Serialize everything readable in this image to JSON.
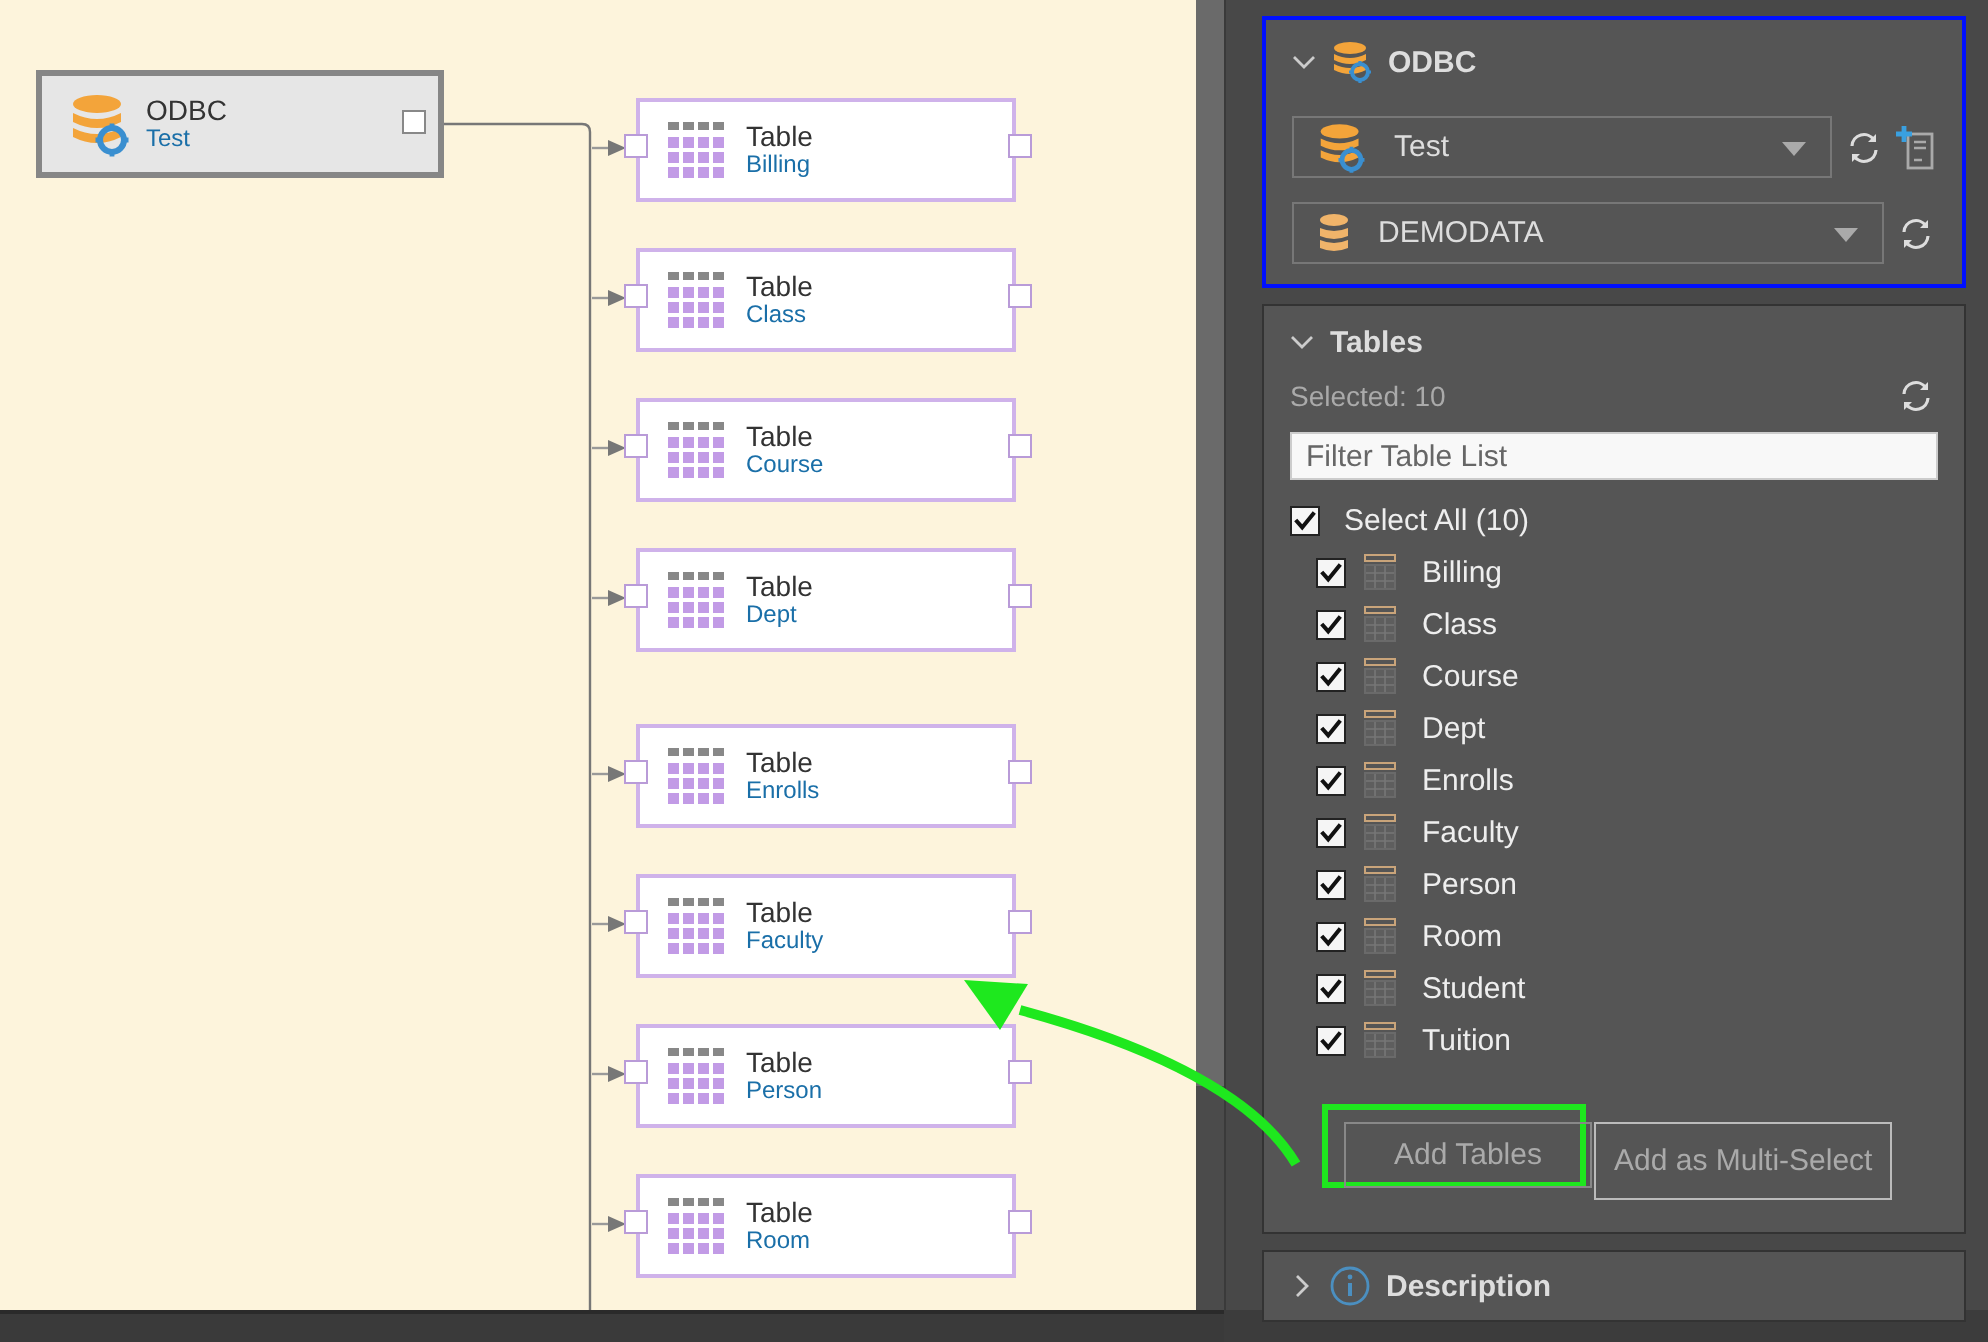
{
  "canvas": {
    "source_node": {
      "title": "ODBC",
      "subtitle": "Test"
    },
    "table_nodes": [
      {
        "title": "Table",
        "name": "Billing"
      },
      {
        "title": "Table",
        "name": "Class"
      },
      {
        "title": "Table",
        "name": "Course"
      },
      {
        "title": "Table",
        "name": "Dept"
      },
      {
        "title": "Table",
        "name": "Enrolls"
      },
      {
        "title": "Table",
        "name": "Faculty"
      },
      {
        "title": "Table",
        "name": "Person"
      },
      {
        "title": "Table",
        "name": "Room"
      }
    ]
  },
  "panel": {
    "odbc_section": {
      "title": "ODBC",
      "expanded": true,
      "connection": "Test",
      "database": "DEMODATA"
    },
    "tables_section": {
      "title": "Tables",
      "expanded": true,
      "selected_count": "Selected: 10",
      "filter_placeholder": "Filter Table List",
      "select_all": {
        "label": "Select All (10)",
        "checked": true
      },
      "tables": [
        {
          "name": "Billing",
          "checked": true
        },
        {
          "name": "Class",
          "checked": true
        },
        {
          "name": "Course",
          "checked": true
        },
        {
          "name": "Dept",
          "checked": true
        },
        {
          "name": "Enrolls",
          "checked": true
        },
        {
          "name": "Faculty",
          "checked": true
        },
        {
          "name": "Person",
          "checked": true
        },
        {
          "name": "Room",
          "checked": true
        },
        {
          "name": "Student",
          "checked": true
        },
        {
          "name": "Tuition",
          "checked": true
        }
      ],
      "buttons": [
        "Add Tables",
        "Add as Multi-Select"
      ]
    },
    "description_section": {
      "title": "Description",
      "expanded": false
    }
  }
}
